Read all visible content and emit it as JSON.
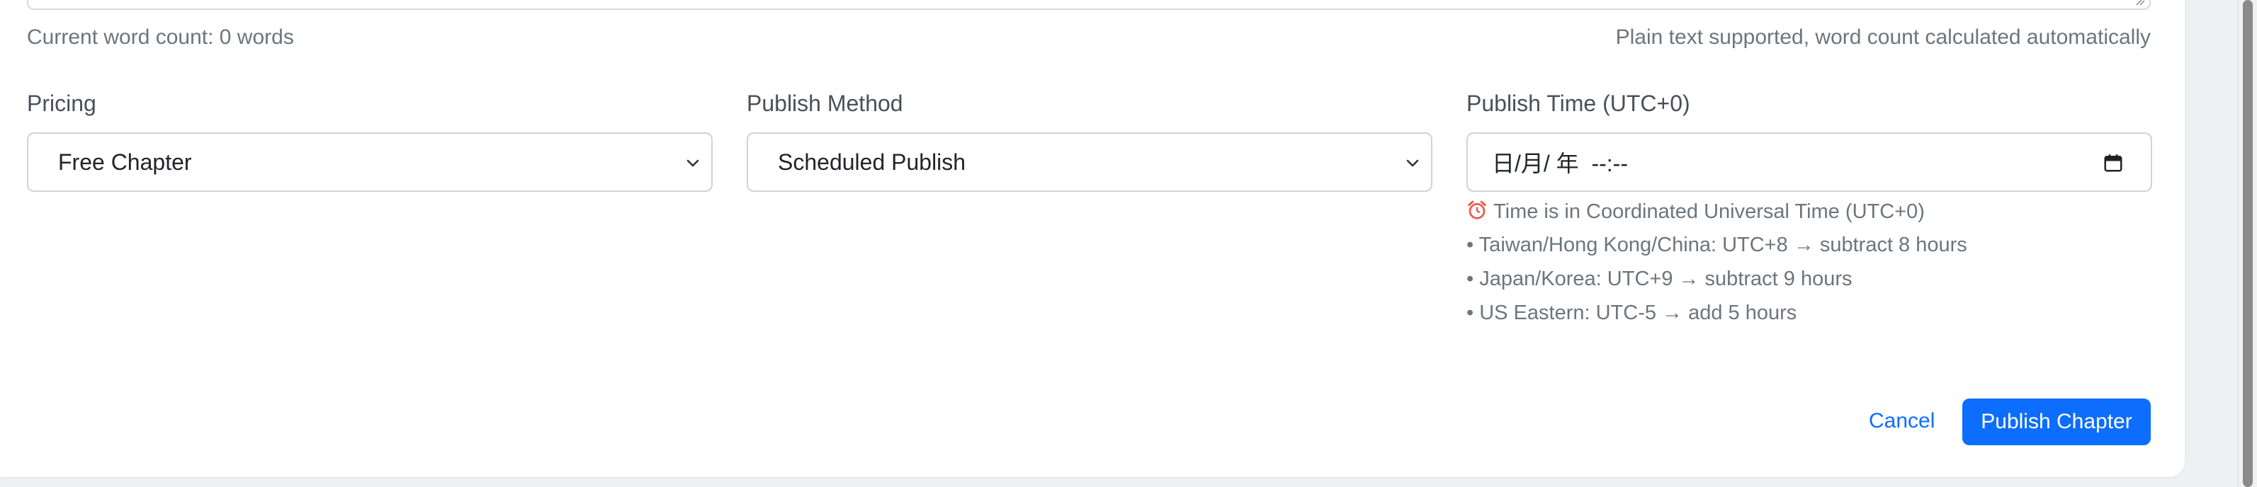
{
  "editor": {
    "word_count": "Current word count: 0 words",
    "helper_text": "Plain text supported, word count calculated automatically"
  },
  "pricing": {
    "label": "Pricing",
    "selected": "Free Chapter"
  },
  "publish_method": {
    "label": "Publish Method",
    "selected": "Scheduled Publish"
  },
  "publish_time": {
    "label": "Publish Time (UTC+0)",
    "placeholder": "日/月/ 年  --:--",
    "notes": [
      "Time is in Coordinated Universal Time (UTC+0)",
      "• Taiwan/Hong Kong/China: UTC+8 → subtract 8 hours",
      "• Japan/Korea: UTC+9 → subtract 9 hours",
      "• US Eastern: UTC-5 → add 5 hours"
    ]
  },
  "actions": {
    "cancel_label": "Cancel",
    "publish_label": "Publish Chapter"
  },
  "colors": {
    "primary": "#0d6efd",
    "muted_text": "#6c757d",
    "border": "#ced4da",
    "alarm_icon": "#e8594f"
  },
  "icons": {
    "alarm": "alarm-clock-icon",
    "calendar": "calendar-icon",
    "chevron": "chevron-down-icon",
    "resize": "resize-grip-icon"
  }
}
